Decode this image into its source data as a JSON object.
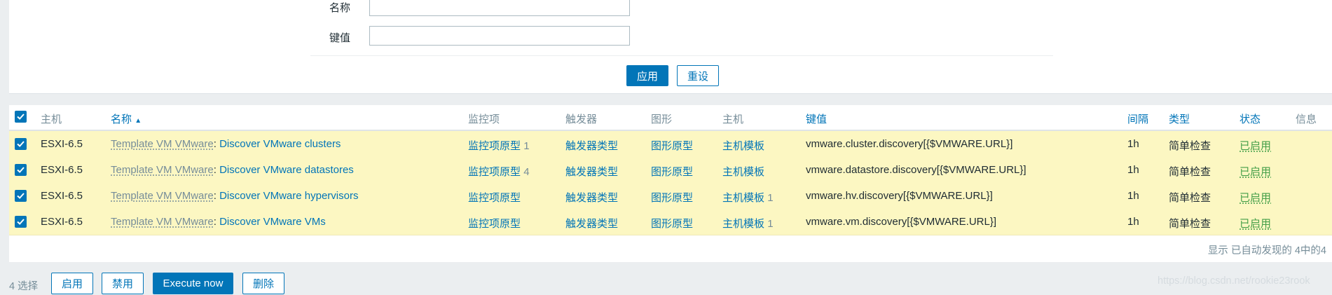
{
  "filter": {
    "name_label": "名称",
    "key_label": "键值",
    "name_value": "",
    "key_value": "",
    "apply_label": "应用",
    "reset_label": "重设"
  },
  "table": {
    "headers": {
      "host": "主机",
      "name": "名称",
      "sort_arrow": "▲",
      "items": "监控项",
      "triggers": "触发器",
      "graphs": "图形",
      "hosts": "主机",
      "key": "键值",
      "interval": "间隔",
      "type": "类型",
      "status": "状态",
      "info": "信息"
    },
    "rows": [
      {
        "host": "ESXI-6.5",
        "template": "Template VM VMware",
        "sep": ":",
        "rule": "Discover VMware clusters",
        "items": "监控项原型",
        "items_count": "1",
        "triggers": "触发器类型",
        "graphs": "图形原型",
        "hosts": "主机模板",
        "hosts_count": "",
        "key": "vmware.cluster.discovery[{$VMWARE.URL}]",
        "interval": "1h",
        "type": "简单检查",
        "status": "已启用",
        "info": ""
      },
      {
        "host": "ESXI-6.5",
        "template": "Template VM VMware",
        "sep": ":",
        "rule": "Discover VMware datastores",
        "items": "监控项原型",
        "items_count": "4",
        "triggers": "触发器类型",
        "graphs": "图形原型",
        "hosts": "主机模板",
        "hosts_count": "",
        "key": "vmware.datastore.discovery[{$VMWARE.URL}]",
        "interval": "1h",
        "type": "简单检查",
        "status": "已启用",
        "info": ""
      },
      {
        "host": "ESXI-6.5",
        "template": "Template VM VMware",
        "sep": ":",
        "rule": "Discover VMware hypervisors",
        "items": "监控项原型",
        "items_count": "",
        "triggers": "触发器类型",
        "graphs": "图形原型",
        "hosts": "主机模板",
        "hosts_count": "1",
        "key": "vmware.hv.discovery[{$VMWARE.URL}]",
        "interval": "1h",
        "type": "简单检查",
        "status": "已启用",
        "info": ""
      },
      {
        "host": "ESXI-6.5",
        "template": "Template VM VMware",
        "sep": ":",
        "rule": "Discover VMware VMs",
        "items": "监控项原型",
        "items_count": "",
        "triggers": "触发器类型",
        "graphs": "图形原型",
        "hosts": "主机模板",
        "hosts_count": "1",
        "key": "vmware.vm.discovery[{$VMWARE.URL}]",
        "interval": "1h",
        "type": "简单检查",
        "status": "已启用",
        "info": ""
      }
    ],
    "footer": "显示 已自动发现的 4中的4"
  },
  "actions": {
    "selected": "4 选择",
    "enable": "启用",
    "disable": "禁用",
    "execute": "Execute now",
    "delete": "删除"
  },
  "watermark": "https://blog.csdn.net/rookie23rook",
  "colors": {
    "accent": "#0275b8",
    "row_highlight": "#fcf7c2",
    "status_enabled": "#429e47",
    "muted": "#768d99"
  }
}
